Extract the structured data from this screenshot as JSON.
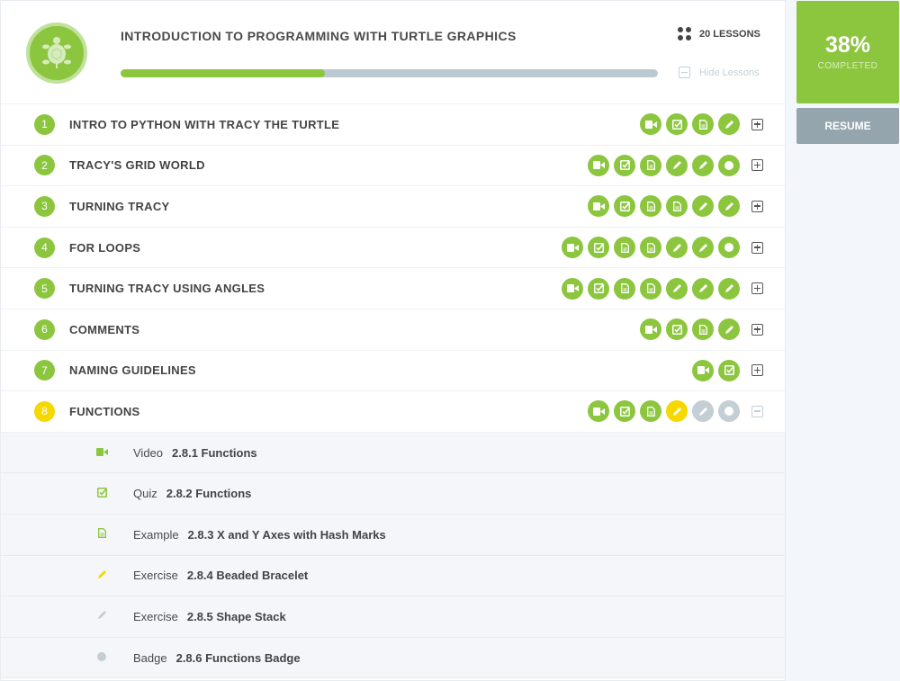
{
  "course": {
    "title": "INTRODUCTION TO PROGRAMMING WITH TURTLE GRAPHICS",
    "progress_percent": 38,
    "lessons_count": "20 LESSONS",
    "hide_label": "Hide Lessons",
    "completed_value": "38%",
    "completed_label": "COMPLETED",
    "resume_label": "RESUME"
  },
  "colors": {
    "green": "#8cc63f",
    "yellow": "#f5d800",
    "grey": "#c3ced5",
    "resume": "#95a5ad"
  },
  "lessons": [
    {
      "num": "1",
      "name": "INTRO TO PYTHON WITH TRACY THE TURTLE",
      "items": [
        "video",
        "quiz",
        "doc",
        "pencil"
      ]
    },
    {
      "num": "2",
      "name": "TRACY'S GRID WORLD",
      "items": [
        "video",
        "quiz",
        "doc",
        "pencil",
        "pencil",
        "badge"
      ]
    },
    {
      "num": "3",
      "name": "TURNING TRACY",
      "items": [
        "video",
        "quiz",
        "doc",
        "doc",
        "pencil",
        "pencil"
      ]
    },
    {
      "num": "4",
      "name": "FOR LOOPS",
      "items": [
        "video",
        "quiz",
        "doc",
        "doc",
        "pencil",
        "pencil",
        "badge"
      ]
    },
    {
      "num": "5",
      "name": "TURNING TRACY USING ANGLES",
      "items": [
        "video",
        "quiz",
        "doc",
        "doc",
        "pencil",
        "pencil",
        "pencil"
      ]
    },
    {
      "num": "6",
      "name": "COMMENTS",
      "items": [
        "video",
        "quiz",
        "doc",
        "pencil"
      ]
    },
    {
      "num": "7",
      "name": "NAMING GUIDELINES",
      "items": [
        "video",
        "quiz"
      ]
    },
    {
      "num": "8",
      "name": "FUNCTIONS",
      "current": true,
      "items": [
        "video",
        "quiz",
        "doc",
        "pencil:yellow",
        "pencil:grey",
        "badge:grey"
      ]
    }
  ],
  "expanded": [
    {
      "icon": "video",
      "state": "green",
      "type": "Video",
      "name": "2.8.1 Functions"
    },
    {
      "icon": "quiz",
      "state": "green",
      "type": "Quiz",
      "name": "2.8.2 Functions"
    },
    {
      "icon": "doc",
      "state": "green",
      "type": "Example",
      "name": "2.8.3 X and Y Axes with Hash Marks"
    },
    {
      "icon": "pencil",
      "state": "yellow",
      "type": "Exercise",
      "name": "2.8.4 Beaded Bracelet"
    },
    {
      "icon": "pencil",
      "state": "grey",
      "type": "Exercise",
      "name": "2.8.5 Shape Stack"
    },
    {
      "icon": "badge",
      "state": "grey",
      "type": "Badge",
      "name": "2.8.6 Functions Badge"
    }
  ]
}
